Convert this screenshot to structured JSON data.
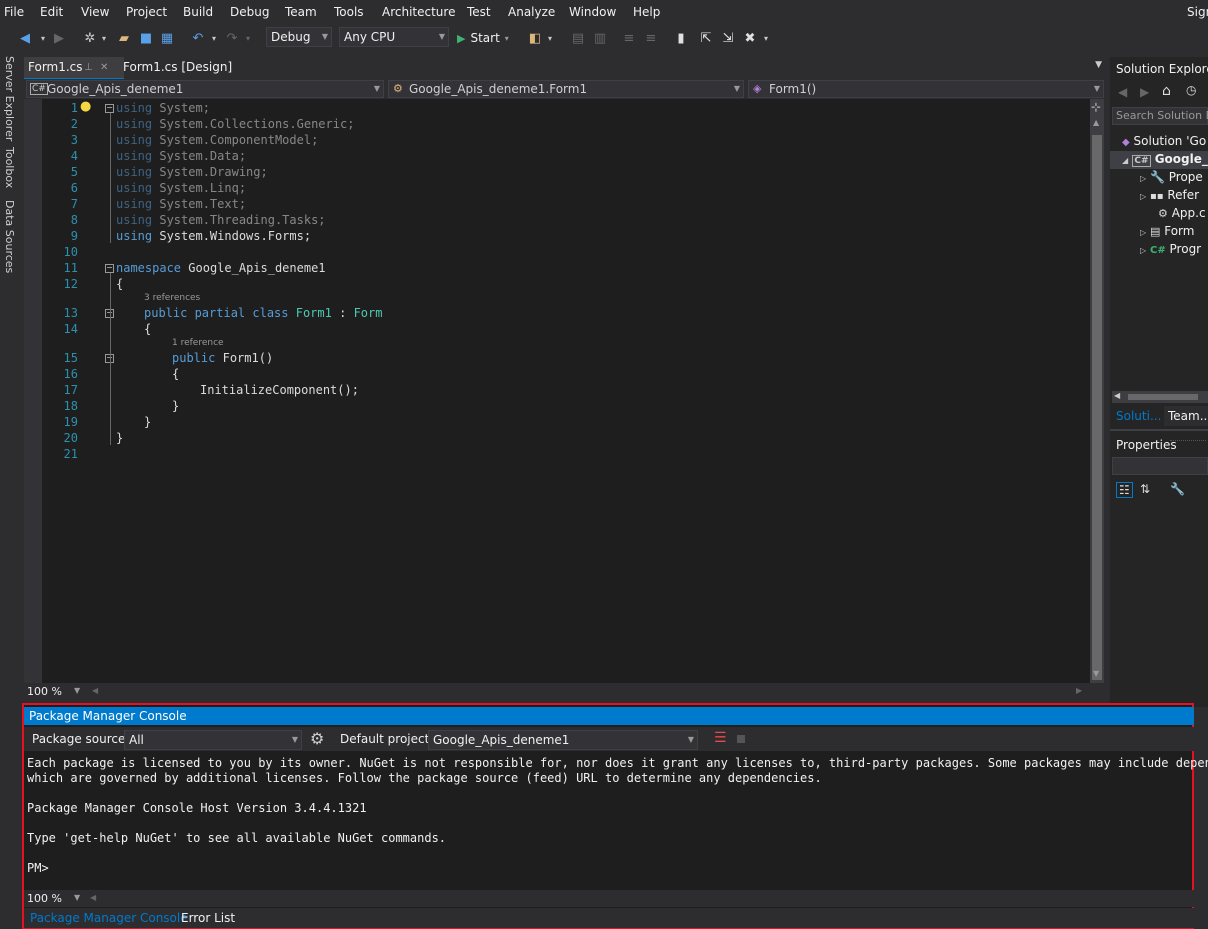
{
  "menu": {
    "items": [
      "File",
      "Edit",
      "View",
      "Project",
      "Build",
      "Debug",
      "Team",
      "Tools",
      "Architecture",
      "Test",
      "Analyze",
      "Window",
      "Help"
    ],
    "signin": "Sign"
  },
  "toolbar": {
    "config": "Debug",
    "platform": "Any CPU",
    "start": "Start"
  },
  "left_tabs": [
    "Server Explorer",
    "Toolbox",
    "Data Sources"
  ],
  "doc_tabs": [
    {
      "label": "Form1.cs",
      "pin": "⊥",
      "close": "✕"
    },
    {
      "label": "Form1.cs [Design]"
    }
  ],
  "nav": {
    "project": "Google_Apis_deneme1",
    "class": "Google_Apis_deneme1.Form1",
    "member": "Form1()"
  },
  "editor": {
    "line_numbers": [
      "1",
      "2",
      "3",
      "4",
      "5",
      "6",
      "7",
      "8",
      "9",
      "10",
      "11",
      "12",
      "13",
      "14",
      "15",
      "16",
      "17",
      "18",
      "19",
      "20",
      "21"
    ],
    "usings": [
      {
        "kw": "using",
        "ns": "System;"
      },
      {
        "kw": "using",
        "ns": "System.Collections.Generic;"
      },
      {
        "kw": "using",
        "ns": "System.ComponentModel;"
      },
      {
        "kw": "using",
        "ns": "System.Data;"
      },
      {
        "kw": "using",
        "ns": "System.Drawing;"
      },
      {
        "kw": "using",
        "ns": "System.Linq;"
      },
      {
        "kw": "using",
        "ns": "System.Text;"
      },
      {
        "kw": "using",
        "ns": "System.Threading.Tasks;"
      },
      {
        "kw": "using",
        "ns": "System.Windows.Forms;"
      }
    ],
    "namespace_kw": "namespace",
    "namespace_name": "Google_Apis_deneme1",
    "open_brace": "{",
    "close_brace": "}",
    "class_refs": "3 references",
    "class_kw": "public partial class",
    "class_name": "Form1",
    "colon": ":",
    "base": "Form",
    "ctor_refs": "1 reference",
    "ctor_kw": "public",
    "ctor_name": "Form1()",
    "call": "InitializeComponent();",
    "zoom": "100 %"
  },
  "solution_explorer": {
    "title": "Solution Explorer",
    "search_placeholder": "Search Solution E",
    "solution": "Solution 'Go",
    "project": "Google_",
    "items": [
      "Prope",
      "Refer",
      "App.c",
      "Form",
      "Progr"
    ],
    "tabs": [
      "Soluti...",
      "Team..."
    ]
  },
  "properties": {
    "title": "Properties"
  },
  "pmc": {
    "title": "Package Manager Console",
    "source_label": "Package source:",
    "source_value": "All",
    "project_label": "Default project:",
    "project_value": "Google_Apis_deneme1",
    "lines": [
      "Each package is licensed to you by its owner. NuGet is not responsible for, nor does it grant any licenses to, third-party packages. Some packages may include dependenci",
      "which are governed by additional licenses. Follow the package source (feed) URL to determine any dependencies.",
      "",
      "Package Manager Console Host Version 3.4.4.1321",
      "",
      "Type 'get-help NuGet' to see all available NuGet commands.",
      "",
      "PM>"
    ],
    "zoom": "100 %",
    "tabs": [
      "Package Manager Console",
      "Error List"
    ]
  },
  "colors": {
    "accent": "#007acc",
    "highlight_border": "#e81123",
    "keyword": "#569cd6",
    "type": "#4ec9b0",
    "line_number": "#2b91af"
  }
}
